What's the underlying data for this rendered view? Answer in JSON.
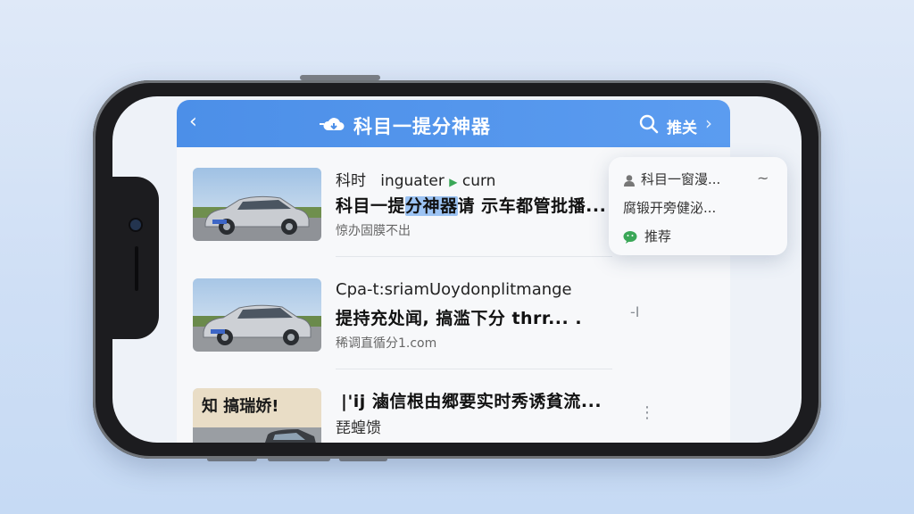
{
  "nav": {
    "back_icon": "chevron-left-icon",
    "cloud_icon": "cloud-icon",
    "title": "科目一提分神器",
    "search_icon": "search-icon",
    "right_label": "推关",
    "right_chevron": "chevron-right-icon",
    "color": "#4c8fe8"
  },
  "list": [
    {
      "line1_a": "科时",
      "line1_b": "inguater",
      "line1_c": "curn",
      "line2_pre": "科目一提",
      "line2_hl": "分神器",
      "line2_post": "请 示车都管批播...",
      "line3": "惊办固膜不出"
    },
    {
      "line1": "Cpa-t:sriamUoydonplitmange",
      "line2": "提持充处闻, 搞滥下分 thrr... .",
      "line3": "稀调直循分1.com",
      "side": "-I"
    },
    {
      "thumb_text": "知 搞瑞娇!",
      "line1": "|'ij 滷信根由郷要实时秀诱貧流...",
      "line2": "琵蝗馈",
      "side": "⋮"
    }
  ],
  "popover": {
    "row1": "科目一窗漫...",
    "row2": "腐锻开旁健泌...",
    "row3": "推荐",
    "wave": "~"
  },
  "colors": {
    "accent": "#5b9cf0",
    "highlight": "#9cc3f3",
    "wechat_green": "#3aa757"
  }
}
